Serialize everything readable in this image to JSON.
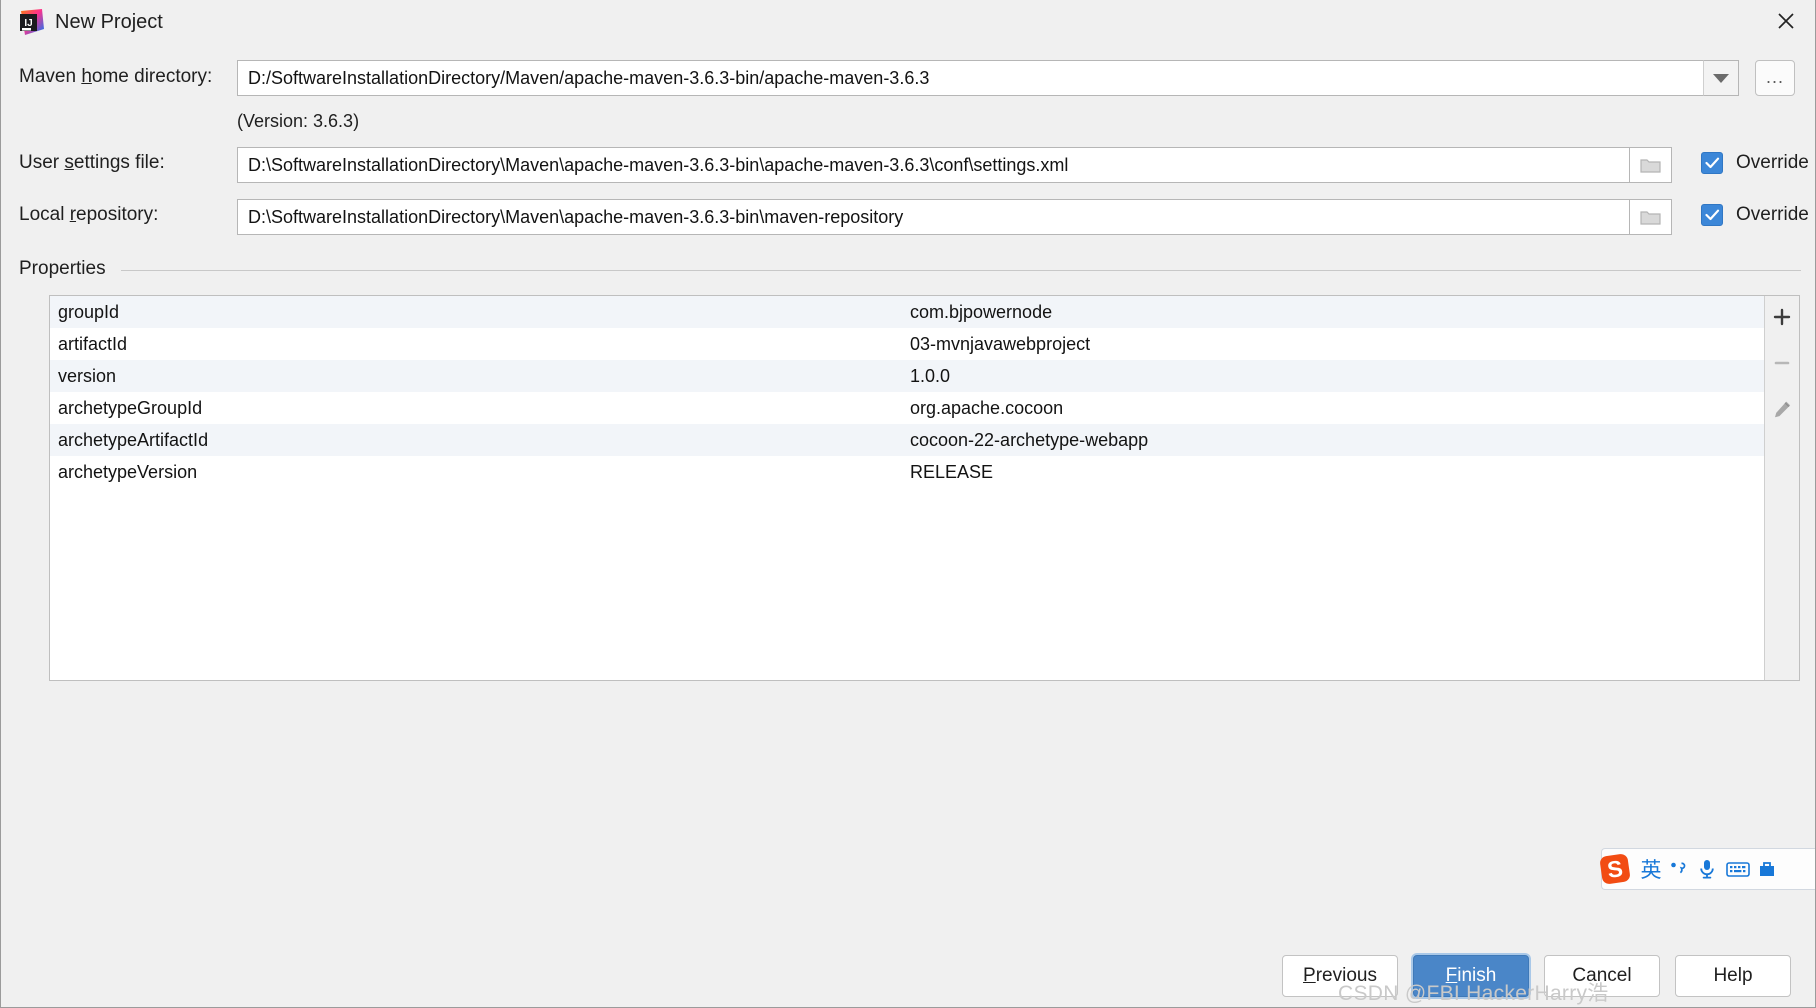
{
  "window": {
    "title": "New Project",
    "app_icon": "intellij-idea-icon",
    "close_icon": "close-icon"
  },
  "form": {
    "maven_home": {
      "label_before": "Maven ",
      "label_mnemonic": "h",
      "label_after": "ome directory:",
      "value": "D:/SoftwareInstallationDirectory/Maven/apache-maven-3.6.3-bin/apache-maven-3.6.3",
      "dropdown_icon": "chevron-down-icon",
      "browse_label": "...",
      "version_note": "(Version: 3.6.3)"
    },
    "user_settings": {
      "label_before": "User ",
      "label_mnemonic": "s",
      "label_after": "ettings file:",
      "value": "D:\\SoftwareInstallationDirectory\\Maven\\apache-maven-3.6.3-bin\\apache-maven-3.6.3\\conf\\settings.xml",
      "folder_icon": "folder-icon",
      "override_label": "Override",
      "override_checked": true
    },
    "local_repository": {
      "label_before": "Local ",
      "label_mnemonic": "r",
      "label_after": "epository:",
      "value": "D:\\SoftwareInstallationDirectory\\Maven\\apache-maven-3.6.3-bin\\maven-repository",
      "folder_icon": "folder-icon",
      "override_label": "Override",
      "override_checked": true
    }
  },
  "properties": {
    "section_title": "Properties",
    "rows": [
      {
        "key": "groupId",
        "value": "com.bjpowernode"
      },
      {
        "key": "artifactId",
        "value": "03-mvnjavawebproject"
      },
      {
        "key": "version",
        "value": "1.0.0"
      },
      {
        "key": "archetypeGroupId",
        "value": "org.apache.cocoon"
      },
      {
        "key": "archetypeArtifactId",
        "value": "cocoon-22-archetype-webapp"
      },
      {
        "key": "archetypeVersion",
        "value": "RELEASE"
      }
    ],
    "toolbar": {
      "add_icon": "plus-icon",
      "remove_icon": "minus-icon",
      "edit_icon": "pencil-icon"
    }
  },
  "ime": {
    "logo": "sogou-logo-icon",
    "mode_label": "英",
    "punctuation_icon": "punctuation-icon",
    "mic_icon": "microphone-icon",
    "keyboard_icon": "keyboard-icon",
    "toolbox_icon": "toolbox-icon"
  },
  "footer": {
    "previous": {
      "before": "",
      "mnemonic": "P",
      "after": "revious"
    },
    "finish": {
      "before": "",
      "mnemonic": "F",
      "after": "inish"
    },
    "cancel": {
      "label": "Cancel"
    },
    "help": {
      "label": "Help"
    }
  },
  "watermark": {
    "text": "CSDN @FBI HackerHarry浩"
  },
  "colors": {
    "accent": "#4a86c8",
    "checkbox": "#3c87d8",
    "dialog_bg": "#f0f0f0",
    "row_alt": "#f2f5f9"
  }
}
